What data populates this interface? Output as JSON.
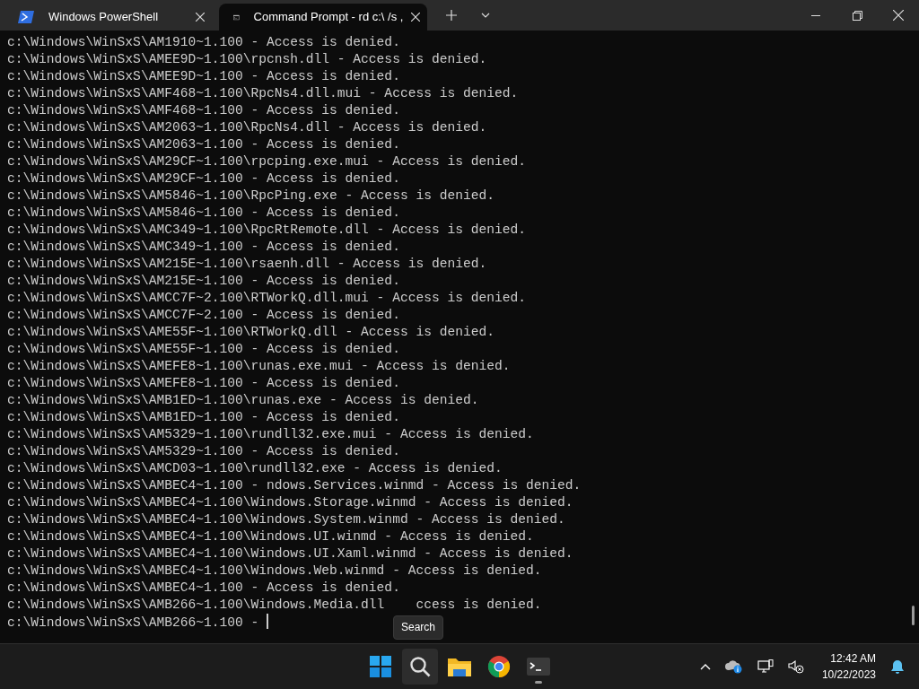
{
  "tabs": [
    {
      "label": "Windows PowerShell",
      "kind": "powershell",
      "selected": false
    },
    {
      "label": "Command Prompt - rd  c:\\ /s ,",
      "kind": "cmd",
      "selected": true
    }
  ],
  "console": {
    "lines": [
      "c:\\Windows\\WinSxS\\AM1910~1.100 - Access is denied.",
      "c:\\Windows\\WinSxS\\AMEE9D~1.100\\rpcnsh.dll - Access is denied.",
      "c:\\Windows\\WinSxS\\AMEE9D~1.100 - Access is denied.",
      "c:\\Windows\\WinSxS\\AMF468~1.100\\RpcNs4.dll.mui - Access is denied.",
      "c:\\Windows\\WinSxS\\AMF468~1.100 - Access is denied.",
      "c:\\Windows\\WinSxS\\AM2063~1.100\\RpcNs4.dll - Access is denied.",
      "c:\\Windows\\WinSxS\\AM2063~1.100 - Access is denied.",
      "c:\\Windows\\WinSxS\\AM29CF~1.100\\rpcping.exe.mui - Access is denied.",
      "c:\\Windows\\WinSxS\\AM29CF~1.100 - Access is denied.",
      "c:\\Windows\\WinSxS\\AM5846~1.100\\RpcPing.exe - Access is denied.",
      "c:\\Windows\\WinSxS\\AM5846~1.100 - Access is denied.",
      "c:\\Windows\\WinSxS\\AMC349~1.100\\RpcRtRemote.dll - Access is denied.",
      "c:\\Windows\\WinSxS\\AMC349~1.100 - Access is denied.",
      "c:\\Windows\\WinSxS\\AM215E~1.100\\rsaenh.dll - Access is denied.",
      "c:\\Windows\\WinSxS\\AM215E~1.100 - Access is denied.",
      "c:\\Windows\\WinSxS\\AMCC7F~2.100\\RTWorkQ.dll.mui - Access is denied.",
      "c:\\Windows\\WinSxS\\AMCC7F~2.100 - Access is denied.",
      "c:\\Windows\\WinSxS\\AME55F~1.100\\RTWorkQ.dll - Access is denied.",
      "c:\\Windows\\WinSxS\\AME55F~1.100 - Access is denied.",
      "c:\\Windows\\WinSxS\\AMEFE8~1.100\\runas.exe.mui - Access is denied.",
      "c:\\Windows\\WinSxS\\AMEFE8~1.100 - Access is denied.",
      "c:\\Windows\\WinSxS\\AMB1ED~1.100\\runas.exe - Access is denied.",
      "c:\\Windows\\WinSxS\\AMB1ED~1.100 - Access is denied.",
      "c:\\Windows\\WinSxS\\AM5329~1.100\\rundll32.exe.mui - Access is denied.",
      "c:\\Windows\\WinSxS\\AM5329~1.100 - Access is denied.",
      "c:\\Windows\\WinSxS\\AMCD03~1.100\\rundll32.exe - Access is denied.",
      "c:\\Windows\\WinSxS\\AMBEC4~1.100 - ndows.Services.winmd - Access is denied.",
      "c:\\Windows\\WinSxS\\AMBEC4~1.100\\Windows.Storage.winmd - Access is denied.",
      "c:\\Windows\\WinSxS\\AMBEC4~1.100\\Windows.System.winmd - Access is denied.",
      "c:\\Windows\\WinSxS\\AMBEC4~1.100\\Windows.UI.winmd - Access is denied.",
      "c:\\Windows\\WinSxS\\AMBEC4~1.100\\Windows.UI.Xaml.winmd - Access is denied.",
      "c:\\Windows\\WinSxS\\AMBEC4~1.100\\Windows.Web.winmd - Access is denied.",
      "c:\\Windows\\WinSxS\\AMBEC4~1.100 - Access is denied."
    ],
    "covered_line": {
      "before": "c:\\Windows\\WinSxS\\AMB266~1.100\\Windows.Media.dll",
      "after": "ccess is denied."
    },
    "prompt_line": "c:\\Windows\\WinSxS\\AMB266~1.100 - "
  },
  "tooltip": "Search",
  "taskbar": {
    "apps": [
      {
        "kind": "start",
        "selected": false
      },
      {
        "kind": "search",
        "selected": true
      },
      {
        "kind": "explorer",
        "selected": false
      },
      {
        "kind": "chrome",
        "selected": false
      },
      {
        "kind": "terminal",
        "selected": false,
        "running": true
      }
    ],
    "time": "12:42 AM",
    "date": "10/22/2023"
  }
}
